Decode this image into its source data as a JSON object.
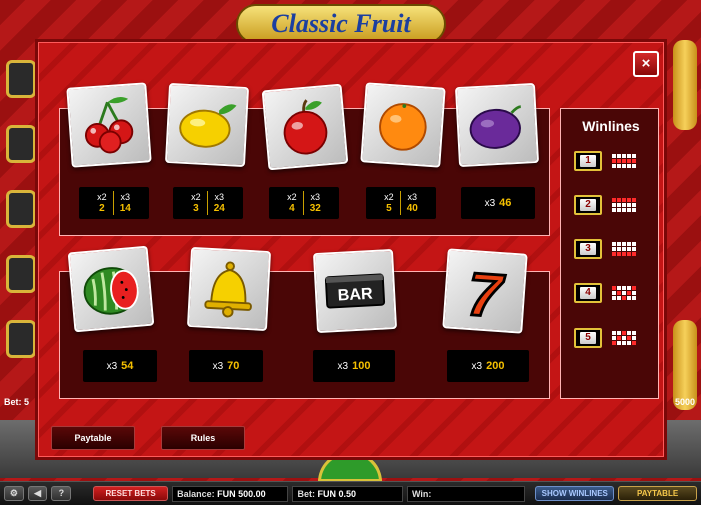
{
  "background": {
    "logo_text": "Classic Fruit",
    "bet_label": "Bet: 5",
    "right_value": "5000"
  },
  "modal": {
    "close_label": "×",
    "winlines_title": "Winlines",
    "top_row": [
      {
        "symbol": "cherries-icon",
        "payouts": [
          {
            "mult": "x2",
            "value": "2"
          },
          {
            "mult": "x3",
            "value": "14"
          }
        ]
      },
      {
        "symbol": "lemon-icon",
        "payouts": [
          {
            "mult": "x2",
            "value": "3"
          },
          {
            "mult": "x3",
            "value": "24"
          }
        ]
      },
      {
        "symbol": "apple-icon",
        "payouts": [
          {
            "mult": "x2",
            "value": "4"
          },
          {
            "mult": "x3",
            "value": "32"
          }
        ]
      },
      {
        "symbol": "orange-icon",
        "payouts": [
          {
            "mult": "x2",
            "value": "5"
          },
          {
            "mult": "x3",
            "value": "40"
          }
        ]
      },
      {
        "symbol": "plum-icon",
        "payouts": [
          {
            "mult": "x3",
            "value": "46"
          }
        ]
      }
    ],
    "bottom_row": [
      {
        "symbol": "watermelon-icon",
        "payouts": [
          {
            "mult": "x3",
            "value": "54"
          }
        ]
      },
      {
        "symbol": "bell-icon",
        "payouts": [
          {
            "mult": "x3",
            "value": "70"
          }
        ]
      },
      {
        "symbol": "bar-icon",
        "bar_text": "BAR",
        "payouts": [
          {
            "mult": "x3",
            "value": "100"
          }
        ]
      },
      {
        "symbol": "seven-icon",
        "seven_text": "7",
        "payouts": [
          {
            "mult": "x3",
            "value": "200"
          }
        ]
      }
    ],
    "winlines": [
      {
        "number": "1",
        "pattern": [
          0,
          0,
          0,
          0,
          0,
          1,
          1,
          1,
          1,
          1,
          0,
          0,
          0,
          0,
          0
        ]
      },
      {
        "number": "2",
        "pattern": [
          1,
          1,
          1,
          1,
          1,
          0,
          0,
          0,
          0,
          0,
          0,
          0,
          0,
          0,
          0
        ]
      },
      {
        "number": "3",
        "pattern": [
          0,
          0,
          0,
          0,
          0,
          0,
          0,
          0,
          0,
          0,
          1,
          1,
          1,
          1,
          1
        ]
      },
      {
        "number": "4",
        "pattern": [
          1,
          0,
          0,
          0,
          1,
          0,
          1,
          0,
          1,
          0,
          0,
          0,
          1,
          0,
          0
        ]
      },
      {
        "number": "5",
        "pattern": [
          0,
          0,
          1,
          0,
          0,
          0,
          1,
          0,
          1,
          0,
          1,
          0,
          0,
          0,
          1
        ]
      }
    ],
    "buttons": {
      "paytable": "Paytable",
      "rules": "Rules"
    },
    "colors": {
      "panel_bg": "#4a0606",
      "modal_bg": "#c41515",
      "payout_value": "#f5c000",
      "active_cell": "#ff2a2a"
    }
  },
  "statusbar": {
    "settings_icon": "⚙",
    "sound_icon": "◀",
    "help_icon": "?",
    "reset_bets": "RESET BETS",
    "balance_label": "Balance:",
    "balance_value": "FUN 500.00",
    "bet_label": "Bet:",
    "bet_value": "FUN 0.50",
    "win_label": "Win:",
    "win_value": "",
    "show_winlines": "SHOW WINLINES",
    "paytable": "PAYTABLE"
  }
}
